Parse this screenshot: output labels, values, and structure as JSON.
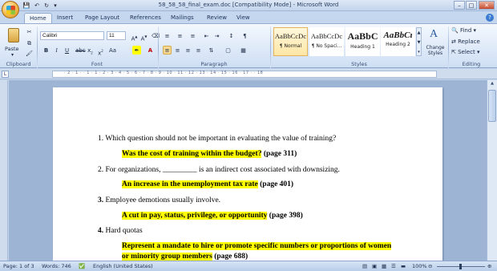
{
  "window": {
    "title": "58_58_58_final_exam.doc [Compatibility Mode] - Microsoft Word"
  },
  "tabs": [
    "Home",
    "Insert",
    "Page Layout",
    "References",
    "Mailings",
    "Review",
    "View"
  ],
  "ribbon": {
    "clipboard": {
      "paste_label": "Paste",
      "group_label": "Clipboard"
    },
    "font": {
      "font_name": "Calibri",
      "font_size": "11",
      "group_label": "Font"
    },
    "paragraph": {
      "group_label": "Paragraph"
    },
    "styles": {
      "group_label": "Styles",
      "items": [
        {
          "preview": "AaBbCcDc",
          "name": "¶ Normal"
        },
        {
          "preview": "AaBbCcDc",
          "name": "¶ No Spaci..."
        },
        {
          "preview": "AaBbC",
          "name": "Heading 1"
        },
        {
          "preview": "AaBbCı",
          "name": "Heading 2"
        }
      ],
      "change_styles_label": "Change Styles"
    },
    "editing": {
      "group_label": "Editing",
      "find": "Find",
      "replace": "Replace",
      "select": "Select"
    }
  },
  "ruler": {
    "numbers": "· 2 · 1 · · 1 · 1 · 2 · 3 · 4 · 5 · 6 · 7 · 8 · 9 · 10 · 11 · 12 · 13 · 14 · 15 · 16 · 17 · · 18"
  },
  "document": {
    "q1": "1. Which question should not be important in evaluating the value of training?",
    "a1_highlight": "Was the cost of training within the budget?",
    "a1_page": " (page 311)",
    "q2": "2. For organizations, _________ is an indirect cost associated with downsizing.",
    "a2_highlight": "An increase in the unemployment tax rate",
    "a2_page": " (page 401)",
    "q3_num": "3.",
    "q3_text": " Employee demotions usually involve.",
    "a3_highlight": "A cut in pay, status, privilege, or opportunity",
    "a3_page": " (page 398)",
    "q4_num": "4.",
    "q4_text": " Hard quotas",
    "a4_line1": "Represent a mandate to hire or promote specific numbers or proportions of women",
    "a4_line2_highlight": "or minority group members",
    "a4_page": " (page 688)"
  },
  "status": {
    "page": "Page: 1 of 3",
    "words": "Words: 746",
    "language": "English (United States)",
    "zoom": "100%"
  }
}
